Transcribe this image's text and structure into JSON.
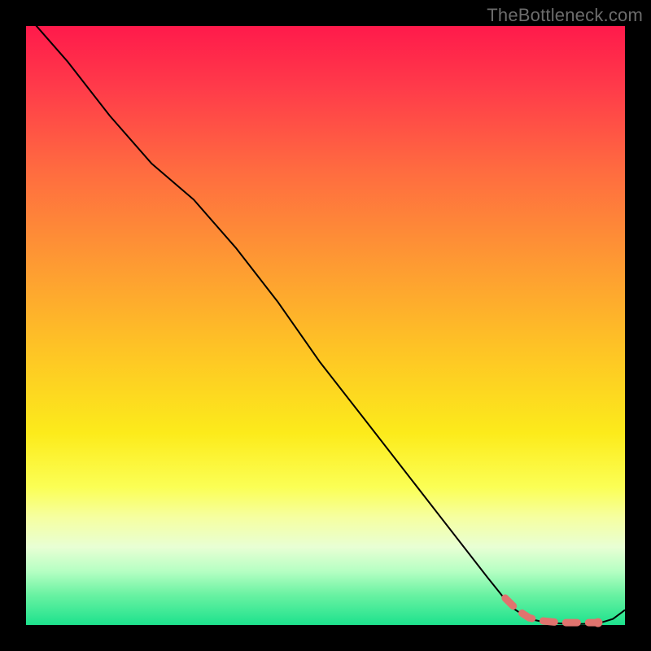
{
  "watermark": "TheBottleneck.com",
  "chart_data": {
    "type": "line",
    "title": "",
    "xlabel": "",
    "ylabel": "",
    "xlim": [
      0,
      100
    ],
    "ylim": [
      0,
      100
    ],
    "grid": false,
    "legend": false,
    "series": [
      {
        "name": "black-curve",
        "color": "#000000",
        "style": "solid",
        "width": 2,
        "x": [
          0,
          7,
          14,
          21,
          28,
          35,
          42,
          49,
          56,
          63,
          70,
          77,
          81,
          84,
          86,
          88,
          90,
          92,
          94,
          96,
          98,
          100
        ],
        "values": [
          102,
          94,
          85,
          77,
          71,
          63,
          54,
          44,
          35,
          26,
          17,
          8,
          3,
          1,
          0.6,
          0.3,
          0.2,
          0.15,
          0.2,
          0.4,
          1.0,
          2.5
        ]
      },
      {
        "name": "pink-highlight",
        "color": "#e0736e",
        "style": "dashed",
        "width": 9,
        "linecap": "round",
        "x": [
          80,
          82,
          84,
          86,
          88,
          90,
          92,
          94,
          95.5
        ],
        "values": [
          4.5,
          2.5,
          1.2,
          0.7,
          0.5,
          0.4,
          0.4,
          0.4,
          0.4
        ]
      }
    ]
  }
}
